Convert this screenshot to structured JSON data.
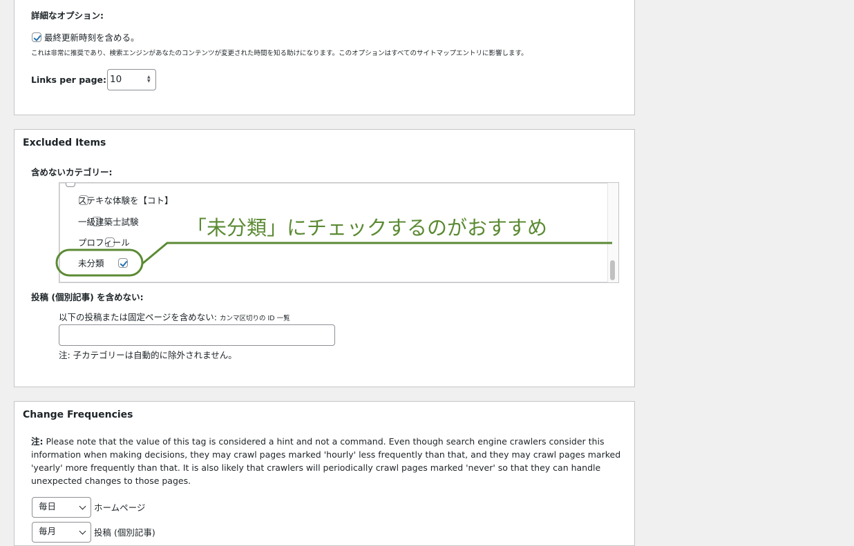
{
  "detailed_options": {
    "heading": "詳細なオプション:",
    "lastmod_label": "最終更新時刻を含める。",
    "lastmod_checked": true,
    "lastmod_note": "これは非常に推奨であり、検索エンジンがあなたのコンテンツが変更された時間を知る助けになります。このオプションはすべてのサイトマップエントリに影響します。",
    "links_per_page_label": "Links per page:",
    "links_per_page_value": "10"
  },
  "excluded": {
    "title": "Excluded Items",
    "categories_label": "含めないカテゴリー:",
    "categories": [
      {
        "label": "ステキな体験を【コト】",
        "checked": false
      },
      {
        "label": "一級建築士試験",
        "checked": false
      },
      {
        "label": "プロフィール",
        "checked": false
      },
      {
        "label": "未分類",
        "checked": true
      }
    ],
    "annotation": "「未分類」にチェックするのがおすすめ",
    "annotation_color": "#5b8a33",
    "posts_label": "投稿 (個別記事) を含めない:",
    "posts_field_label": "以下の投稿または固定ページを含めない:",
    "posts_field_hint": "カンマ区切りの ID 一覧",
    "posts_field_value": "",
    "note": "注: 子カテゴリーは自動的に除外されません。"
  },
  "change_freq": {
    "title": "Change Frequencies",
    "note_prefix": "注:",
    "note_line1": "Please note that the value of this tag is considered a hint and not a command. Even though search engine crawlers consider this",
    "note_line2": "information when making decisions, they may crawl pages marked 'hourly' less frequently than that, and they may crawl pages marked",
    "note_line3": "'yearly' more frequently than that. It is also likely that crawlers will periodically crawl pages marked 'never' so that they can handle",
    "note_line4": "unexpected changes to those pages.",
    "rows": [
      {
        "value": "毎日",
        "label": "ホームページ"
      },
      {
        "value": "毎月",
        "label": "投稿 (個別記事)"
      }
    ]
  }
}
